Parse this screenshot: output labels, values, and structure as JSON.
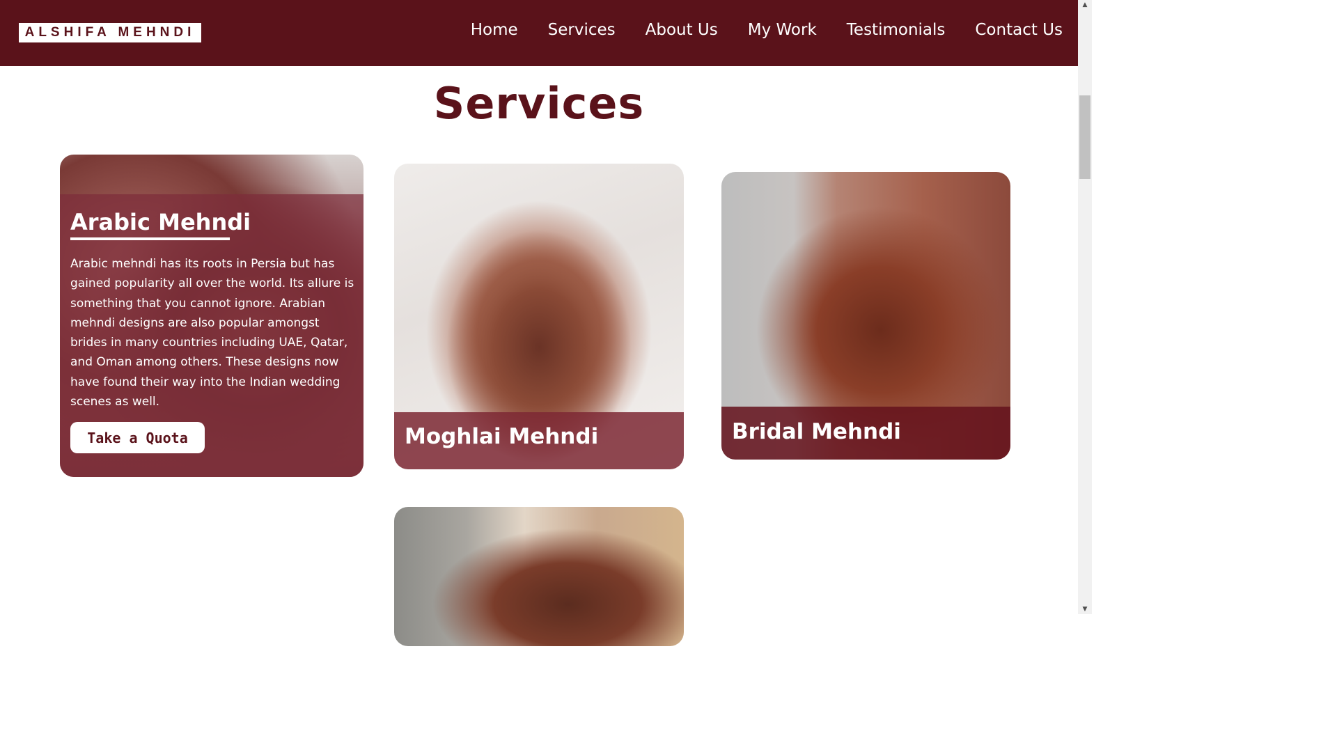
{
  "navbar": {
    "logo_text": "ALSHIFA MEHNDI",
    "links": [
      "Home",
      "Services",
      "About Us",
      "My Work",
      "Testimonials",
      "Contact Us"
    ]
  },
  "services": {
    "title": "Services",
    "cards": [
      {
        "title": "Arabic Mehndi",
        "description": "Arabic mehndi has its roots in Persia but has gained popularity all over the world. Its allure is something that you cannot ignore. Arabian mehndi designs are also popular amongst brides in many countries including UAE, Qatar, and Oman among others. These designs now have found their way into the Indian wedding scenes as well.",
        "button_label": "Take a Quota"
      },
      {
        "title": "Moghlai Mehndi"
      },
      {
        "title": "Bridal Mehndi"
      }
    ]
  },
  "colors": {
    "brand": "#5a121a",
    "overlay": "#7d2d3a",
    "text_on_dark": "#ffffff"
  }
}
